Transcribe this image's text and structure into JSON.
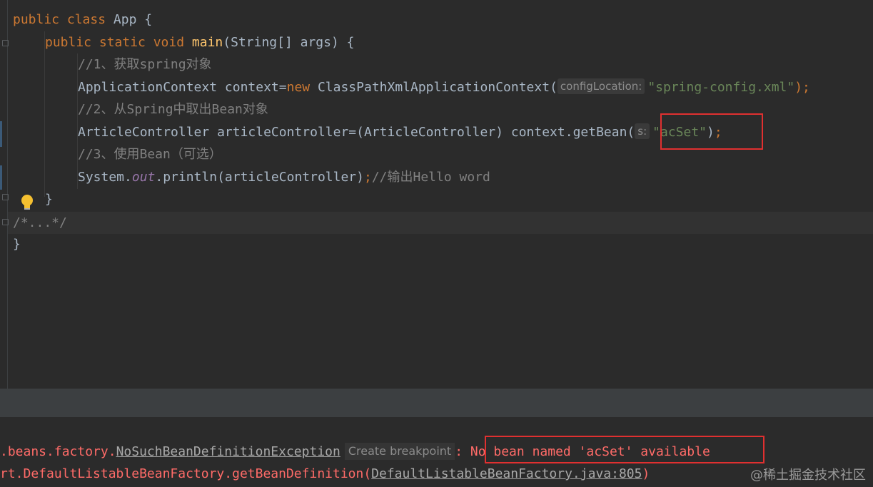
{
  "editor": {
    "lines": {
      "class_decl": {
        "kw": "public class ",
        "name": "App",
        "brace": " {"
      },
      "main_decl": {
        "kw": "public static void ",
        "fn": "main",
        "params": "(String[] args) {"
      },
      "comment1": "//1、获取spring对象",
      "context_line": {
        "start": "ApplicationContext context=",
        "kw_new": "new",
        "class_call": " ClassPathXmlApplicationContext(",
        "hint": "configLocation:",
        "string": "\"spring-config.xml\"",
        "end": ");"
      },
      "comment2": "//2、从Spring中取出Bean对象",
      "getbean_line": {
        "start": "ArticleController articleController=(ArticleController) context.getBean(",
        "hint": "s:",
        "string": "\"acSet\"",
        "close": ")",
        "semicolon": ";"
      },
      "comment3": "//3、使用Bean（可选）",
      "println_line": {
        "start": "System.",
        "out": "out",
        "call": ".println(articleController)",
        "semicolon": ";",
        "comment": "//输出Hello word"
      },
      "close_method": "}",
      "folded_comment": "/*...*/",
      "close_class": "}"
    }
  },
  "console": {
    "line1": {
      "prefix": ".beans.factory.",
      "exception": "NoSuchBeanDefinitionException",
      "chip": "Create breakpoint",
      "message": ": No bean named 'acSet' available"
    },
    "line2": {
      "prefix": "rt.DefaultListableBeanFactory.getBeanDefinition(",
      "location": "DefaultListableBeanFactory.java:805",
      "suffix": ")"
    }
  },
  "watermark": "@稀土掘金技术社区",
  "colors": {
    "keyword": "#cc7832",
    "function": "#ffc66d",
    "string": "#6a8759",
    "comment": "#808080",
    "error": "#ff6b68",
    "highlight_box": "#e03030"
  }
}
